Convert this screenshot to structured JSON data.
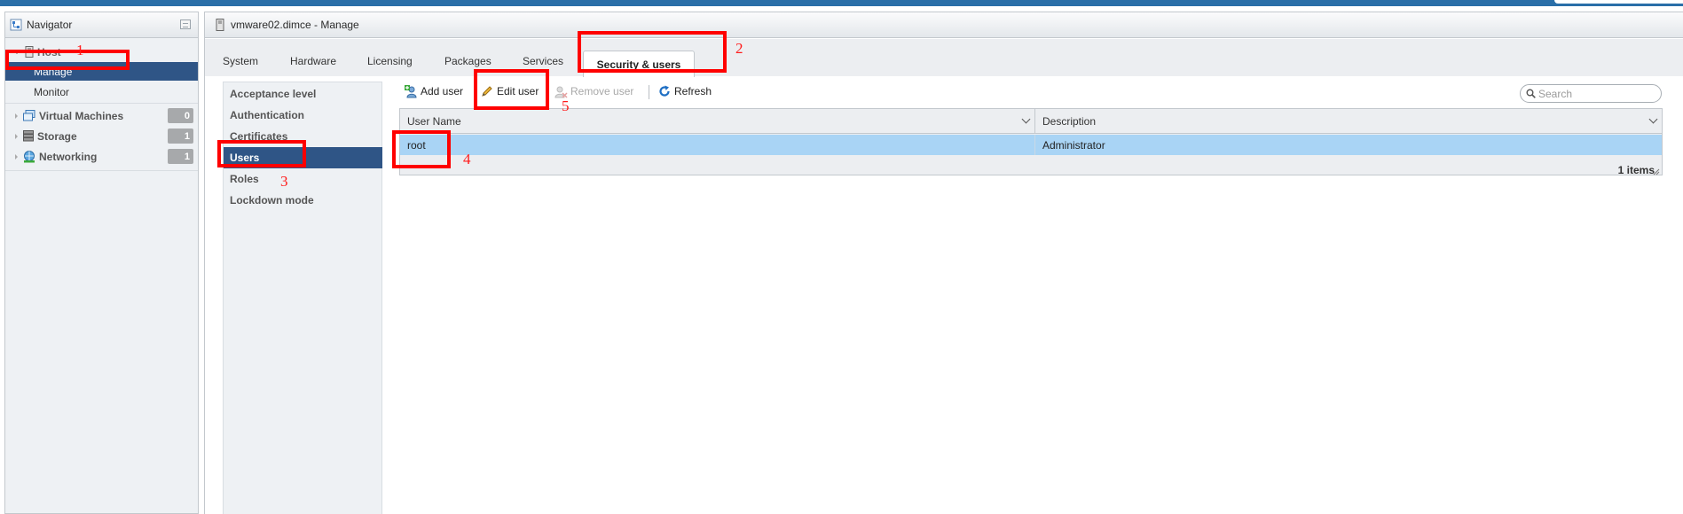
{
  "navigator": {
    "title": "Navigator",
    "host": {
      "label": "Host",
      "children": [
        {
          "label": "Manage"
        },
        {
          "label": "Monitor"
        }
      ]
    },
    "items": [
      {
        "label": "Virtual Machines",
        "count": "0"
      },
      {
        "label": "Storage",
        "count": "1"
      },
      {
        "label": "Networking",
        "count": "1"
      }
    ]
  },
  "main": {
    "title": "vmware02.dimce - Manage",
    "tabs": [
      {
        "label": "System"
      },
      {
        "label": "Hardware"
      },
      {
        "label": "Licensing"
      },
      {
        "label": "Packages"
      },
      {
        "label": "Services"
      },
      {
        "label": "Security & users",
        "active": true
      }
    ],
    "submenu": [
      {
        "label": "Acceptance level"
      },
      {
        "label": "Authentication"
      },
      {
        "label": "Certificates"
      },
      {
        "label": "Users",
        "selected": true
      },
      {
        "label": "Roles"
      },
      {
        "label": "Lockdown mode"
      }
    ],
    "toolbar": {
      "add_user": "Add user",
      "edit_user": "Edit user",
      "remove_user": "Remove user",
      "refresh": "Refresh"
    },
    "search": {
      "placeholder": "Search",
      "value": ""
    },
    "grid": {
      "columns": [
        "User Name",
        "Description"
      ],
      "rows": [
        {
          "user_name": "root",
          "description": "Administrator",
          "selected": true
        }
      ],
      "footer": "1 items"
    }
  },
  "annotations": [
    "1",
    "2",
    "3",
    "4",
    "5"
  ],
  "colors": {
    "selection": "#2f5586",
    "highlight": "#ff0000",
    "row_selected": "#a9d4f5",
    "topbar": "#2a6fa8"
  }
}
